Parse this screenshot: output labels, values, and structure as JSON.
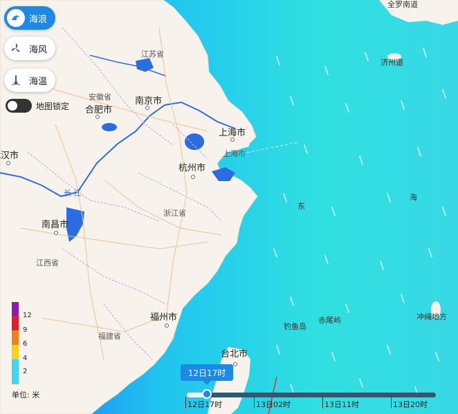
{
  "layers": [
    {
      "label": "海浪",
      "icon": "wave-icon",
      "active": true
    },
    {
      "label": "海风",
      "icon": "fan-icon",
      "active": false
    },
    {
      "label": "海温",
      "icon": "thermometer-icon",
      "active": false
    }
  ],
  "lock_label": "地图锁定",
  "lock_on": false,
  "legend": {
    "values": [
      "12",
      "9",
      "6",
      "4",
      "2"
    ],
    "colors": [
      "#8e1ab0",
      "#e0202a",
      "#f07f1c",
      "#f6d21e",
      "#3fd6f0"
    ],
    "unit": "单位: 米"
  },
  "timeline": {
    "current": "12日17时",
    "ticks": [
      "12日17时",
      "13日02时",
      "13日11时",
      "13日20时"
    ],
    "progress": 0.08
  },
  "places": {
    "jiangsu": "江苏省",
    "anhui": "安徽省",
    "hefei": "合肥市",
    "nanjing": "南京市",
    "shanghai": "上海市",
    "shanghai2": "上海市",
    "hangzhou": "杭州市",
    "wuhan": "武汉市",
    "nanchang": "南昌市",
    "zhejiang": "浙江省",
    "jiangxi": "江西省",
    "fujian": "福建省",
    "fuzhou": "福州市",
    "taibei": "台北市",
    "diaoyu": "钓鱼岛",
    "chiwei": "赤尾屿",
    "jeju": "济州道",
    "jeonnam": "全罗南道",
    "okinawa": "冲绳地方",
    "dong": "东",
    "hai": "海",
    "river": "长 江"
  }
}
